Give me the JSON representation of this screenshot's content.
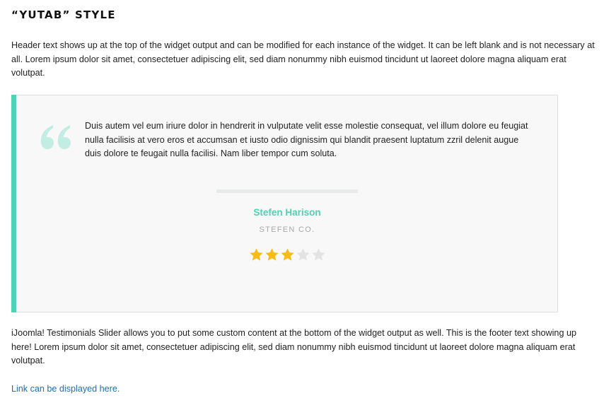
{
  "widget": {
    "title": "“YUTAB” STYLE",
    "header_text": "Header text shows up at the top of the widget output and can be modified for each instance of the widget. It can be left blank and is not necessary at all. Lorem ipsum dolor sit amet, consectetuer adipiscing elit, sed diam nonummy nibh euismod tincidunt ut laoreet dolore magna aliquam erat volutpat.",
    "footer_text": "iJoomla! Testimonials Slider allows you to put some custom content at the bottom of the widget output as well. This is the footer text showing up here! Lorem ipsum dolor sit amet, consectetuer adipiscing elit, sed diam nonummy nibh euismod tincidunt ut laoreet dolore magna aliquam erat volutpat.",
    "link_text": "Link can be displayed here."
  },
  "testimonial": {
    "quote_icon": "quote-icon",
    "quote": "Duis autem vel eum iriure dolor in hendrerit in vulputate velit esse molestie consequat, vel illum dolore eu feugiat nulla facilisis at vero eros et accumsan et iusto odio dignissim qui blandit praesent luptatum zzril delenit augue duis dolore te feugait nulla facilisi. Nam liber tempor cum soluta.",
    "author_name": "Stefen Harison",
    "author_company": "STEFEN CO.",
    "rating": 3,
    "rating_max": 5
  },
  "colors": {
    "accent": "#4fd1b5",
    "quote_icon": "#c3ece3",
    "star_filled": "#f7bb1b",
    "star_empty": "#e3e3e3",
    "link": "#1f6fb5"
  }
}
